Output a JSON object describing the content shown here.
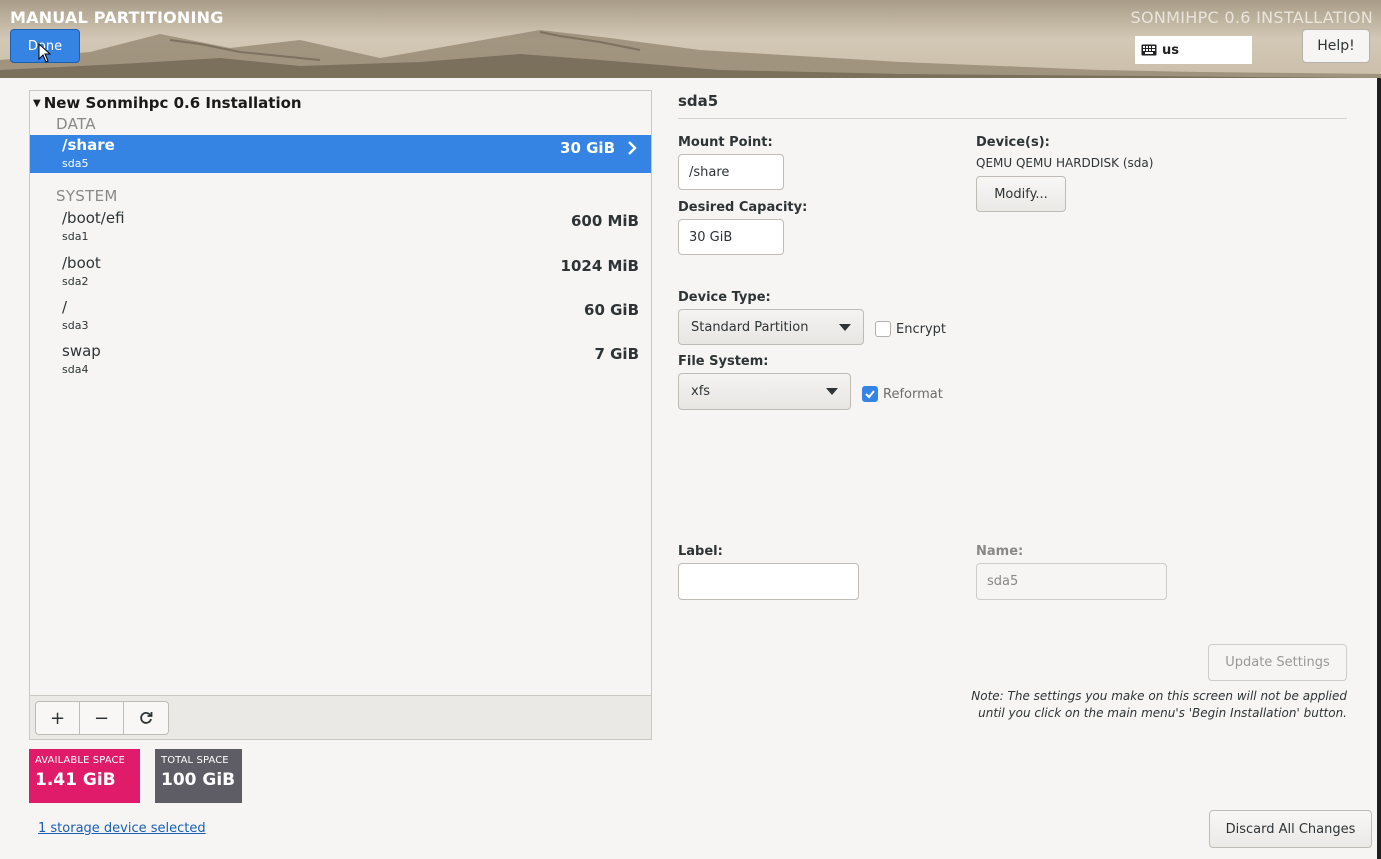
{
  "header": {
    "title": "MANUAL PARTITIONING",
    "product": "SONMIHPC 0.6 INSTALLATION",
    "done_label": "Done",
    "keyboard_layout": "us",
    "help_label": "Help!"
  },
  "tree": {
    "root_label": "New Sonmihpc 0.6 Installation",
    "groups": [
      {
        "label": "DATA",
        "partitions": [
          {
            "mount": "/share",
            "device": "sda5",
            "size": "30 GiB",
            "selected": true
          }
        ]
      },
      {
        "label": "SYSTEM",
        "partitions": [
          {
            "mount": "/boot/efi",
            "device": "sda1",
            "size": "600 MiB"
          },
          {
            "mount": "/boot",
            "device": "sda2",
            "size": "1024 MiB"
          },
          {
            "mount": "/",
            "device": "sda3",
            "size": "60 GiB"
          },
          {
            "mount": "swap",
            "device": "sda4",
            "size": "7 GiB"
          }
        ]
      }
    ],
    "toolbar": {
      "add": "+",
      "remove": "−",
      "refresh": "⟳"
    }
  },
  "space": {
    "available_label": "AVAILABLE SPACE",
    "available_value": "1.41 GiB",
    "total_label": "TOTAL SPACE",
    "total_value": "100 GiB"
  },
  "storage_link": "1 storage device selected",
  "details": {
    "title": "sda5",
    "mount_point_label": "Mount Point:",
    "mount_point_value": "/share",
    "capacity_label": "Desired Capacity:",
    "capacity_value": "30 GiB",
    "devices_label": "Device(s):",
    "devices_value": "QEMU QEMU HARDDISK (sda)",
    "modify_label": "Modify...",
    "device_type_label": "Device Type:",
    "device_type_value": "Standard Partition",
    "encrypt_label": "Encrypt",
    "encrypt_checked": false,
    "filesystem_label": "File System:",
    "filesystem_value": "xfs",
    "reformat_label": "Reformat",
    "reformat_checked": true,
    "label_label": "Label:",
    "label_value": "",
    "name_label": "Name:",
    "name_value": "sda5",
    "update_label": "Update Settings",
    "note": "Note:  The settings you make on this screen will not be applied until you click on the main menu's 'Begin Installation' button.",
    "discard_label": "Discard All Changes"
  },
  "colors": {
    "accent": "#3584e4",
    "available": "#e01b6a",
    "total": "#5e5c64"
  }
}
